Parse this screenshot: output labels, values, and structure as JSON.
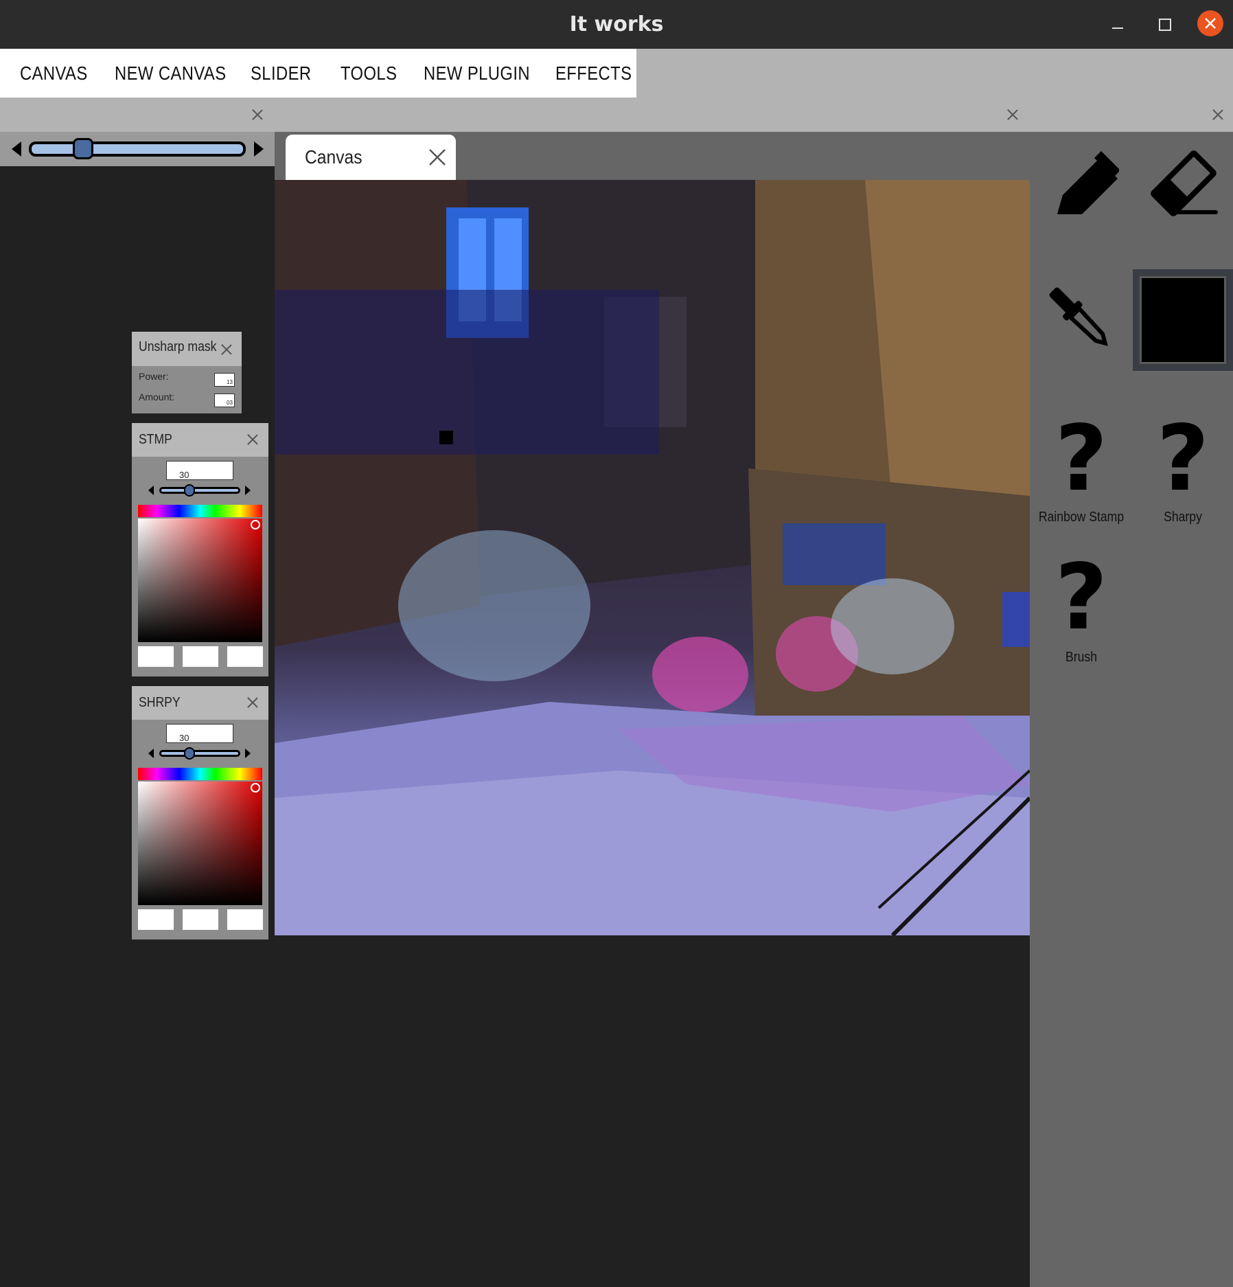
{
  "window": {
    "title": "It works",
    "close_color": "#e95420"
  },
  "menu": {
    "items": [
      "CANVAS",
      "NEW CANVAS",
      "SLIDER",
      "TOOLS",
      "NEW PLUGIN",
      "EFFECTS"
    ]
  },
  "canvas": {
    "tab_label": "Canvas"
  },
  "unsharp": {
    "title": "Unsharp mask",
    "power_label": "Power:",
    "power_value": "13",
    "amount_label": "Amount:",
    "amount_value": "03"
  },
  "stmp": {
    "title": "STMP",
    "size_value": "30"
  },
  "shrpy": {
    "title": "SHRPY",
    "size_value": "30"
  },
  "tools": {
    "pencil": "pencil-icon",
    "eraser": "eraser-icon",
    "pipette": "pipette-icon",
    "current_color": "#000000",
    "rainbow_stamp_label": "Rainbow Stamp",
    "sharpy_label": "Sharpy",
    "brush_label": "Brush",
    "unknown_glyph": "?"
  }
}
